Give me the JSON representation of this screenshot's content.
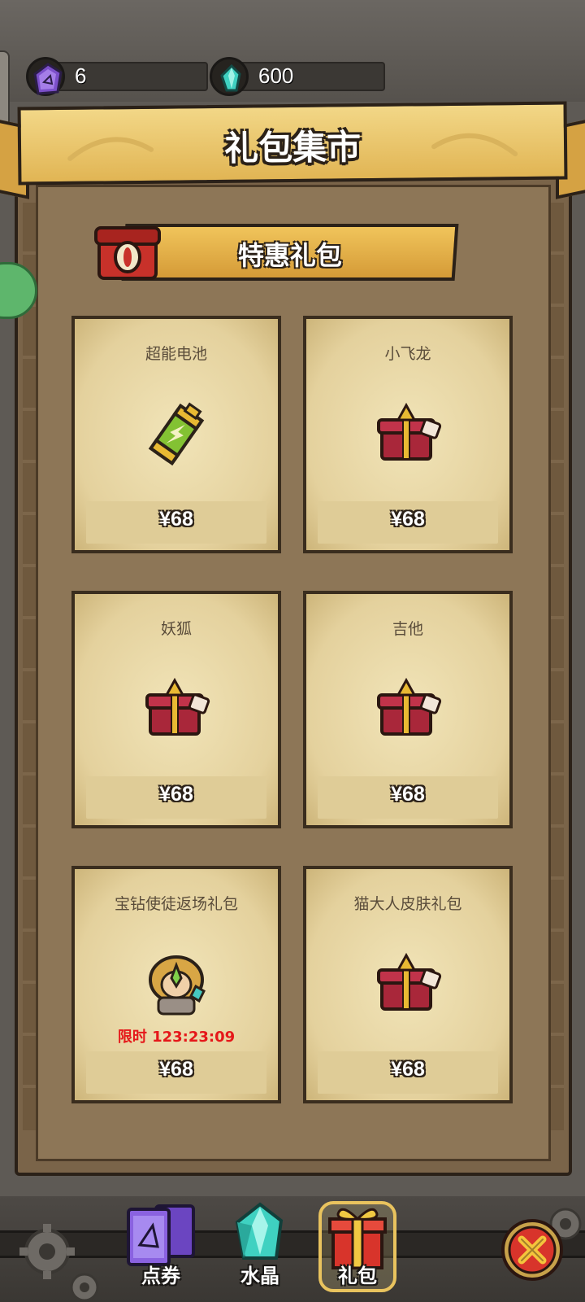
{
  "currencies": {
    "coupon": {
      "value": "6",
      "icon": "purple-card-icon"
    },
    "crystal": {
      "value": "600",
      "icon": "teal-crystal-icon"
    }
  },
  "header": {
    "title": "礼包集市"
  },
  "section": {
    "title": "特惠礼包",
    "icon": "red-chest-icon"
  },
  "packs": [
    {
      "name": "超能电池",
      "price": "¥68",
      "icon": "battery-icon"
    },
    {
      "name": "小飞龙",
      "price": "¥68",
      "icon": "gift-chest-icon"
    },
    {
      "name": "妖狐",
      "price": "¥68",
      "icon": "gift-chest-icon"
    },
    {
      "name": "吉他",
      "price": "¥68",
      "icon": "gift-chest-icon"
    },
    {
      "name": "宝钻使徒返场礼包",
      "price": "¥68",
      "limit": "限时 123:23:09",
      "icon": "hero-portrait-icon"
    },
    {
      "name": "猫大人皮肤礼包",
      "price": "¥68",
      "icon": "gift-chest-icon"
    }
  ],
  "tabs": [
    {
      "label": "点券",
      "icon": "coupon-cards-icon"
    },
    {
      "label": "水晶",
      "icon": "crystal-icon"
    },
    {
      "label": "礼包",
      "icon": "gift-box-icon",
      "selected": true
    }
  ],
  "colors": {
    "accent": "#e9c35e",
    "limit": "#e5181a",
    "parchment": "#efe2b5"
  }
}
